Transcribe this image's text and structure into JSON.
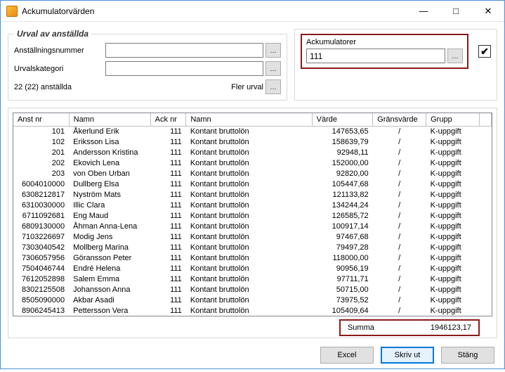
{
  "window": {
    "title": "Ackumulatorvärden",
    "min_icon": "—",
    "max_icon": "□",
    "close_icon": "✕"
  },
  "urval": {
    "legend": "Urval av anställda",
    "anst_label": "Anställningsnummer",
    "anst_value": "",
    "kat_label": "Urvalskategori",
    "kat_value": "",
    "count_text": "22 (22) anställda",
    "fler_urval": "Fler urval",
    "ellipsis": "..."
  },
  "ack": {
    "label": "Ackumulatorer",
    "value": "111",
    "ellipsis": "...",
    "check": "✔"
  },
  "grid": {
    "headers": {
      "anstnr": "Anst nr",
      "namn1": "Namn",
      "acknr": "Ack nr",
      "namn2": "Namn",
      "varde": "Värde",
      "grans": "Gränsvärde",
      "grupp": "Grupp"
    },
    "rows": [
      {
        "anstnr": "101",
        "namn1": "Åkerlund Erik",
        "acknr": "111",
        "namn2": "Kontant bruttolön",
        "varde": "147653,65",
        "grans": "/",
        "grupp": "K-uppgift"
      },
      {
        "anstnr": "102",
        "namn1": "Eriksson Lisa",
        "acknr": "111",
        "namn2": "Kontant bruttolön",
        "varde": "158639,79",
        "grans": "/",
        "grupp": "K-uppgift"
      },
      {
        "anstnr": "201",
        "namn1": "Andersson Kristina",
        "acknr": "111",
        "namn2": "Kontant bruttolön",
        "varde": "92948,11",
        "grans": "/",
        "grupp": "K-uppgift"
      },
      {
        "anstnr": "202",
        "namn1": "Ekovich Lena",
        "acknr": "111",
        "namn2": "Kontant bruttolön",
        "varde": "152000,00",
        "grans": "/",
        "grupp": "K-uppgift"
      },
      {
        "anstnr": "203",
        "namn1": "von Oben Urban",
        "acknr": "111",
        "namn2": "Kontant bruttolön",
        "varde": "92820,00",
        "grans": "/",
        "grupp": "K-uppgift"
      },
      {
        "anstnr": "6004010000",
        "namn1": "Dullberg Elsa",
        "acknr": "111",
        "namn2": "Kontant bruttolön",
        "varde": "105447,68",
        "grans": "/",
        "grupp": "K-uppgift"
      },
      {
        "anstnr": "6308212817",
        "namn1": "Nyström Mats",
        "acknr": "111",
        "namn2": "Kontant bruttolön",
        "varde": "121133,82",
        "grans": "/",
        "grupp": "K-uppgift"
      },
      {
        "anstnr": "6310030000",
        "namn1": "Illic Clara",
        "acknr": "111",
        "namn2": "Kontant bruttolön",
        "varde": "134244,24",
        "grans": "/",
        "grupp": "K-uppgift"
      },
      {
        "anstnr": "6711092681",
        "namn1": "Eng Maud",
        "acknr": "111",
        "namn2": "Kontant bruttolön",
        "varde": "126585,72",
        "grans": "/",
        "grupp": "K-uppgift"
      },
      {
        "anstnr": "6809130000",
        "namn1": "Åhman Anna-Lena",
        "acknr": "111",
        "namn2": "Kontant bruttolön",
        "varde": "100917,14",
        "grans": "/",
        "grupp": "K-uppgift"
      },
      {
        "anstnr": "7103226697",
        "namn1": "Modig Jens",
        "acknr": "111",
        "namn2": "Kontant bruttolön",
        "varde": "97467,68",
        "grans": "/",
        "grupp": "K-uppgift"
      },
      {
        "anstnr": "7303040542",
        "namn1": "Mollberg Marina",
        "acknr": "111",
        "namn2": "Kontant bruttolön",
        "varde": "79497,28",
        "grans": "/",
        "grupp": "K-uppgift"
      },
      {
        "anstnr": "7306057956",
        "namn1": "Göransson Peter",
        "acknr": "111",
        "namn2": "Kontant bruttolön",
        "varde": "118000,00",
        "grans": "/",
        "grupp": "K-uppgift"
      },
      {
        "anstnr": "7504046744",
        "namn1": "Endré Helena",
        "acknr": "111",
        "namn2": "Kontant bruttolön",
        "varde": "90956,19",
        "grans": "/",
        "grupp": "K-uppgift"
      },
      {
        "anstnr": "7612052898",
        "namn1": "Salem Emma",
        "acknr": "111",
        "namn2": "Kontant bruttolön",
        "varde": "97711,71",
        "grans": "/",
        "grupp": "K-uppgift"
      },
      {
        "anstnr": "8302125508",
        "namn1": "Johansson Anna",
        "acknr": "111",
        "namn2": "Kontant bruttolön",
        "varde": "50715,00",
        "grans": "/",
        "grupp": "K-uppgift"
      },
      {
        "anstnr": "8505090000",
        "namn1": "Akbar Asadi",
        "acknr": "111",
        "namn2": "Kontant bruttolön",
        "varde": "73975,52",
        "grans": "/",
        "grupp": "K-uppgift"
      },
      {
        "anstnr": "8906245413",
        "namn1": "Pettersson Vera",
        "acknr": "111",
        "namn2": "Kontant bruttolön",
        "varde": "105409,64",
        "grans": "/",
        "grupp": "K-uppgift"
      }
    ]
  },
  "sum": {
    "label": "Summa",
    "value": "1946123,17"
  },
  "footer": {
    "excel": "Excel",
    "print": "Skriv ut",
    "close": "Stäng"
  }
}
